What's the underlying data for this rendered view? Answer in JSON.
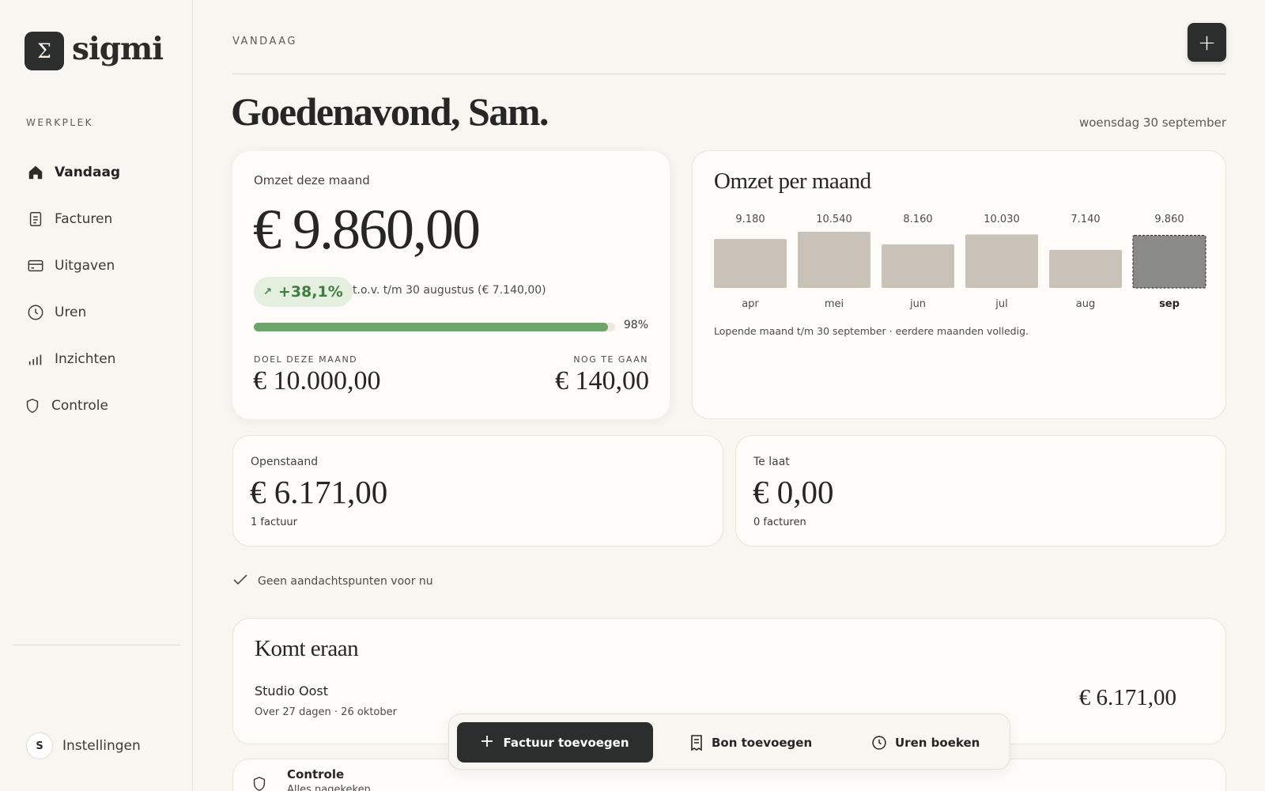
{
  "brand": {
    "logo_symbol": "Σ",
    "name": "sigmi"
  },
  "sidebar": {
    "heading": "WERKPLEK",
    "items": [
      {
        "label": "Vandaag",
        "icon": "home-icon",
        "active": true
      },
      {
        "label": "Facturen",
        "icon": "document-icon"
      },
      {
        "label": "Uitgaven",
        "icon": "card-icon"
      },
      {
        "label": "Uren",
        "icon": "clock-icon"
      },
      {
        "label": "Inzichten",
        "icon": "bar-chart-icon"
      },
      {
        "label": "Controle",
        "icon": "shield-icon"
      }
    ],
    "settings": {
      "avatar_initial": "S",
      "label": "Instellingen"
    }
  },
  "header": {
    "section_label": "VANDAAG",
    "add_button_symbol": "+",
    "greeting": "Goedenavond, Sam.",
    "date": "woensdag 30 september"
  },
  "revenue_card": {
    "title": "Omzet deze maand",
    "amount": "€ 9.860,00",
    "growth_arrow": "↗",
    "growth": "+38,1%",
    "comparison": "t.o.v. t/m 30 augustus (€ 7.140,00)",
    "progress_fraction": 0.98,
    "progress_label": "98%",
    "goal_label": "DOEL DEZE MAAND",
    "goal_amount": "€ 10.000,00",
    "remaining_label": "NOG TE GAAN",
    "remaining_amount": "€ 140,00"
  },
  "chart_card": {
    "title": "Omzet per maand",
    "note": "Lopende maand t/m 30 september · eerdere maanden volledig."
  },
  "chart_data": {
    "type": "bar",
    "categories": [
      "apr",
      "mei",
      "jun",
      "jul",
      "aug",
      "sep"
    ],
    "values": [
      9180,
      10540,
      8160,
      10030,
      7140,
      9860
    ],
    "value_labels": [
      "9.180",
      "10.540",
      "8.160",
      "10.030",
      "7.140",
      "9.860"
    ],
    "highlight_category": "sep",
    "colors": {
      "bar": "#c8c2b8",
      "highlight": "#8a8a88"
    },
    "title": "Omzet per maand",
    "grid": false
  },
  "outstanding": {
    "label": "Openstaand",
    "amount": "€ 6.171,00",
    "sub": "1 factuur"
  },
  "overdue": {
    "label": "Te laat",
    "amount": "€ 0,00",
    "sub": "0 facturen"
  },
  "notice": {
    "text": "Geen aandachtspunten voor nu"
  },
  "upcoming": {
    "title": "Komt eraan",
    "client": "Studio Oost",
    "meta": "Over 27 dagen · 26 oktober",
    "amount": "€ 6.171,00"
  },
  "control": {
    "title": "Controle",
    "sub": "Alles nagekeken"
  },
  "action_bar": {
    "primary": "Factuur toevoegen",
    "receipt": "Bon toevoegen",
    "hours": "Uren boeken"
  },
  "colors": {
    "accent_dark": "#2b2e2c",
    "positive": "#3f7d3f",
    "progress": "#6ea56c",
    "background": "#f8f6f0"
  }
}
